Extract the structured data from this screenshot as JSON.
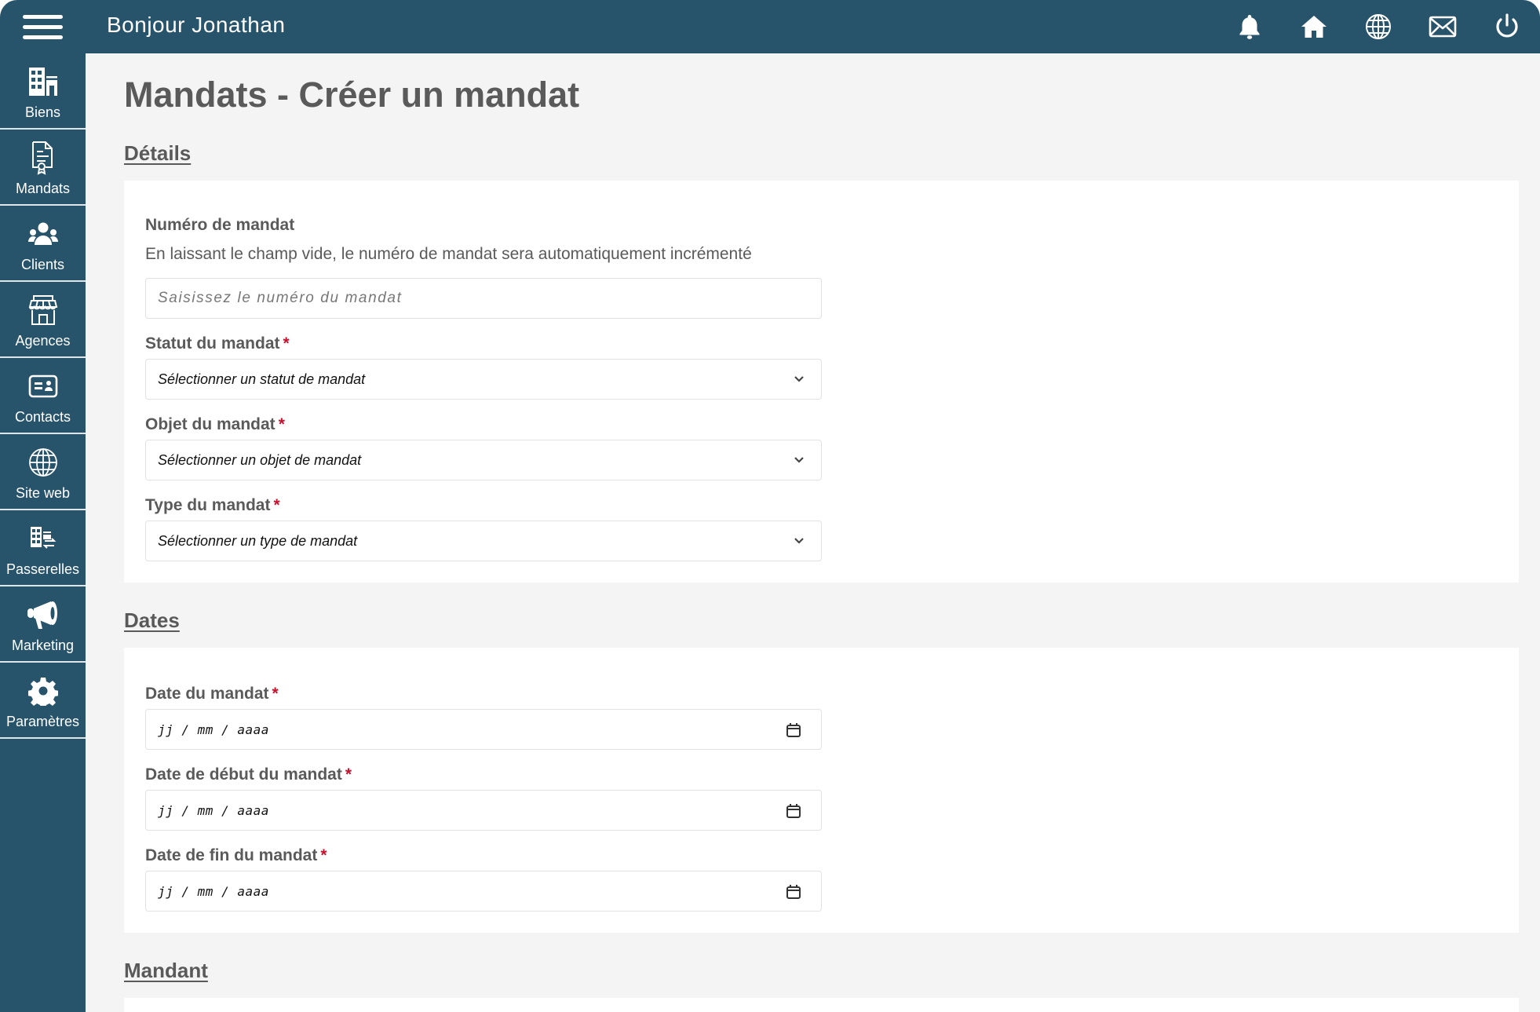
{
  "header": {
    "greeting": "Bonjour Jonathan",
    "icons": [
      "bell-icon",
      "home-icon",
      "globe-icon",
      "mail-icon",
      "power-icon"
    ]
  },
  "sidebar": {
    "items": [
      {
        "label": "Biens",
        "icon": "buildings-icon"
      },
      {
        "label": "Mandats",
        "icon": "certificate-document-icon"
      },
      {
        "label": "Clients",
        "icon": "users-group-icon"
      },
      {
        "label": "Agences",
        "icon": "storefront-icon"
      },
      {
        "label": "Contacts",
        "icon": "contact-card-icon"
      },
      {
        "label": "Site web",
        "icon": "globe-icon"
      },
      {
        "label": "Passerelles",
        "icon": "building-transfer-icon"
      },
      {
        "label": "Marketing",
        "icon": "megaphone-icon"
      },
      {
        "label": "Paramètres",
        "icon": "gear-icon"
      }
    ]
  },
  "page": {
    "title": "Mandats - Créer un mandat"
  },
  "sections": {
    "details": {
      "title": "Détails",
      "numero": {
        "label": "Numéro de mandat",
        "help": "En laissant le champ vide, le numéro de mandat sera automatiquement incrémenté",
        "placeholder": "Saisissez le numéro du mandat",
        "value": ""
      },
      "statut": {
        "label": "Statut du mandat",
        "required": "*",
        "selected": "Sélectionner un statut de mandat"
      },
      "objet": {
        "label": "Objet du mandat",
        "required": "*",
        "selected": "Sélectionner un objet de mandat"
      },
      "type": {
        "label": "Type du mandat",
        "required": "*",
        "selected": "Sélectionner un type de mandat"
      }
    },
    "dates": {
      "title": "Dates",
      "date_mandat": {
        "label": "Date du mandat",
        "required": "*",
        "placeholder": "jj / mm / aaaa"
      },
      "date_debut": {
        "label": "Date de début du mandat",
        "required": "*",
        "placeholder": "jj / mm / aaaa"
      },
      "date_fin": {
        "label": "Date de fin du mandat",
        "required": "*",
        "placeholder": "jj / mm / aaaa"
      }
    },
    "mandant": {
      "title": "Mandant"
    }
  },
  "colors": {
    "brand": "#27536b",
    "background": "#f4f4f4",
    "required": "#c8102e",
    "text": "#5a5a5a"
  }
}
